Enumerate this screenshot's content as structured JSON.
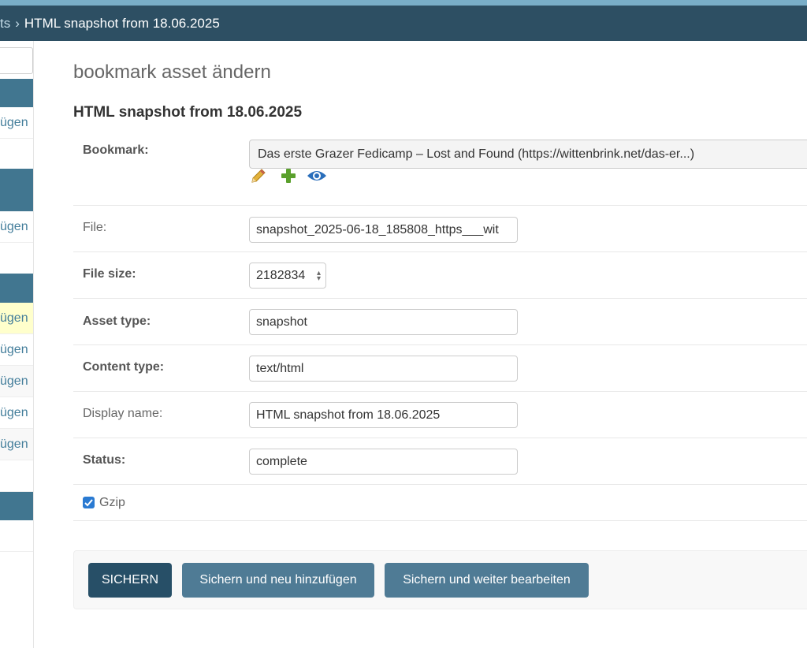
{
  "breadcrumbs": {
    "prev_fragment": "ts",
    "separator": "›",
    "current": "HTML snapshot from 18.06.2025"
  },
  "sidebar": {
    "add_labels": [
      "ügen",
      "ügen",
      "ügen",
      "ügen",
      "ügen",
      "ügen",
      "ügen"
    ]
  },
  "page_title": "bookmark asset ändern",
  "object_title": "HTML snapshot from 18.06.2025",
  "fields": {
    "bookmark": {
      "label": "Bookmark:",
      "value": "Das erste Grazer Fedicamp – Lost and Found (https://wittenbrink.net/das-er...)"
    },
    "file": {
      "label": "File:",
      "value": "snapshot_2025-06-18_185808_https___wit"
    },
    "file_size": {
      "label": "File size:",
      "value": "2182834"
    },
    "asset_type": {
      "label": "Asset type:",
      "value": "snapshot"
    },
    "content_type": {
      "label": "Content type:",
      "value": "text/html"
    },
    "display_name": {
      "label": "Display name:",
      "value": "HTML snapshot from 18.06.2025"
    },
    "status": {
      "label": "Status:",
      "value": "complete"
    },
    "gzip": {
      "label": "Gzip",
      "checked": true
    }
  },
  "icons": [
    "pencil-icon",
    "plus-icon",
    "eye-icon"
  ],
  "buttons": {
    "save": "SICHERN",
    "save_add": "Sichern und neu hinzufügen",
    "save_continue": "Sichern und weiter bearbeiten"
  },
  "colors": {
    "header": "#2d4f63",
    "top_strip": "#79aec8",
    "primary_button": "#274f67",
    "secondary_button": "#4f7b95",
    "link": "#447e9b"
  }
}
